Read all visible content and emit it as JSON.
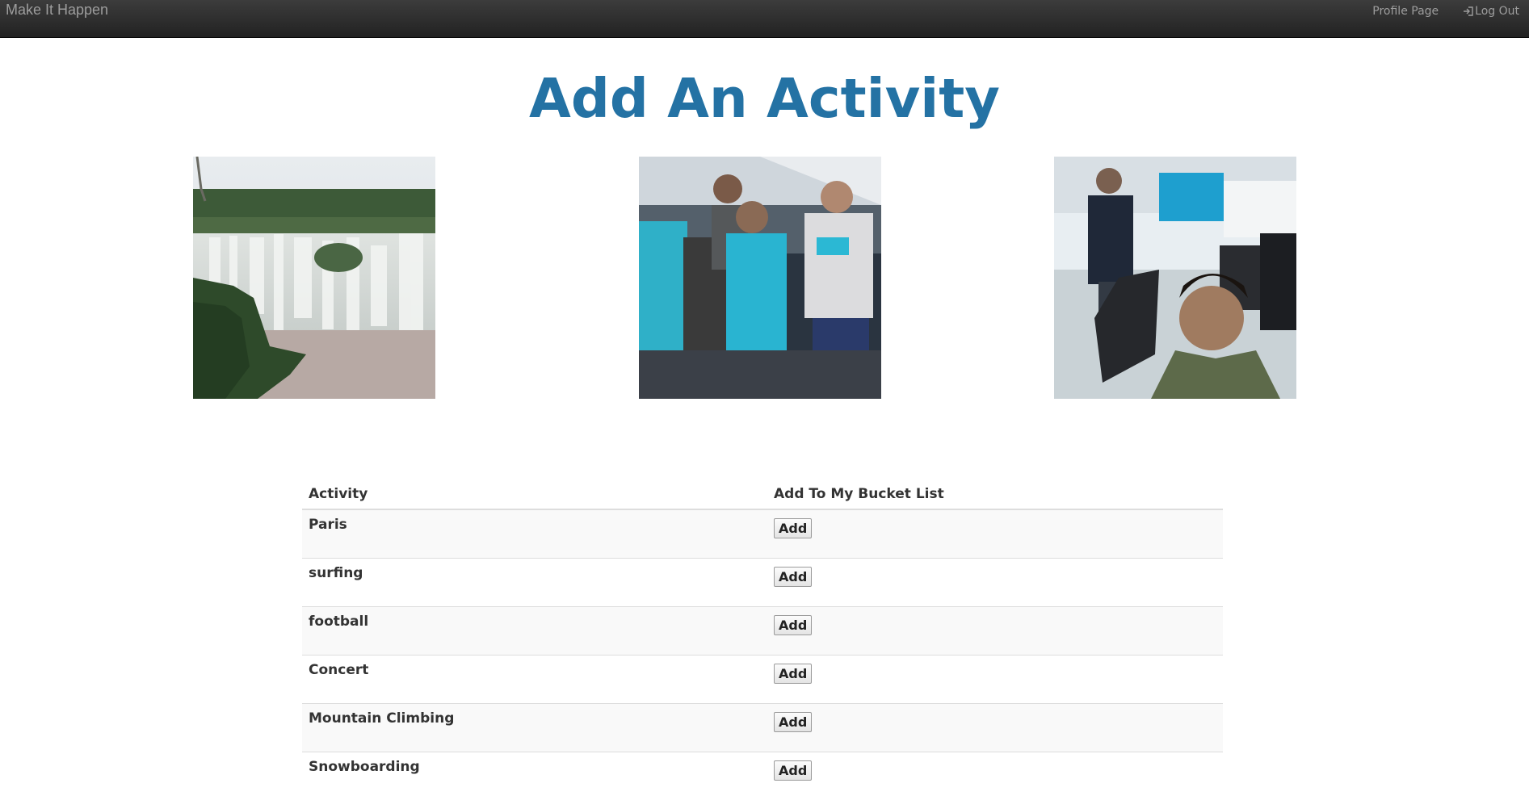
{
  "navbar": {
    "brand": "Make It Happen",
    "profile_link": "Profile Page",
    "logout_link": "Log Out",
    "logout_icon": "log-out-icon"
  },
  "page": {
    "title": "Add An Activity",
    "title_color": "#2472a4"
  },
  "photos": [
    {
      "name": "waterfall-photo"
    },
    {
      "name": "marathon-runners-photo"
    },
    {
      "name": "office-selfie-photo"
    }
  ],
  "table": {
    "headers": {
      "activity": "Activity",
      "add": "Add To My Bucket List"
    },
    "rows": [
      {
        "activity": "Paris",
        "button": "Add"
      },
      {
        "activity": "surfing",
        "button": "Add"
      },
      {
        "activity": "football",
        "button": "Add"
      },
      {
        "activity": "Concert",
        "button": "Add"
      },
      {
        "activity": "Mountain Climbing",
        "button": "Add"
      },
      {
        "activity": "Snowboarding",
        "button": "Add"
      }
    ]
  }
}
